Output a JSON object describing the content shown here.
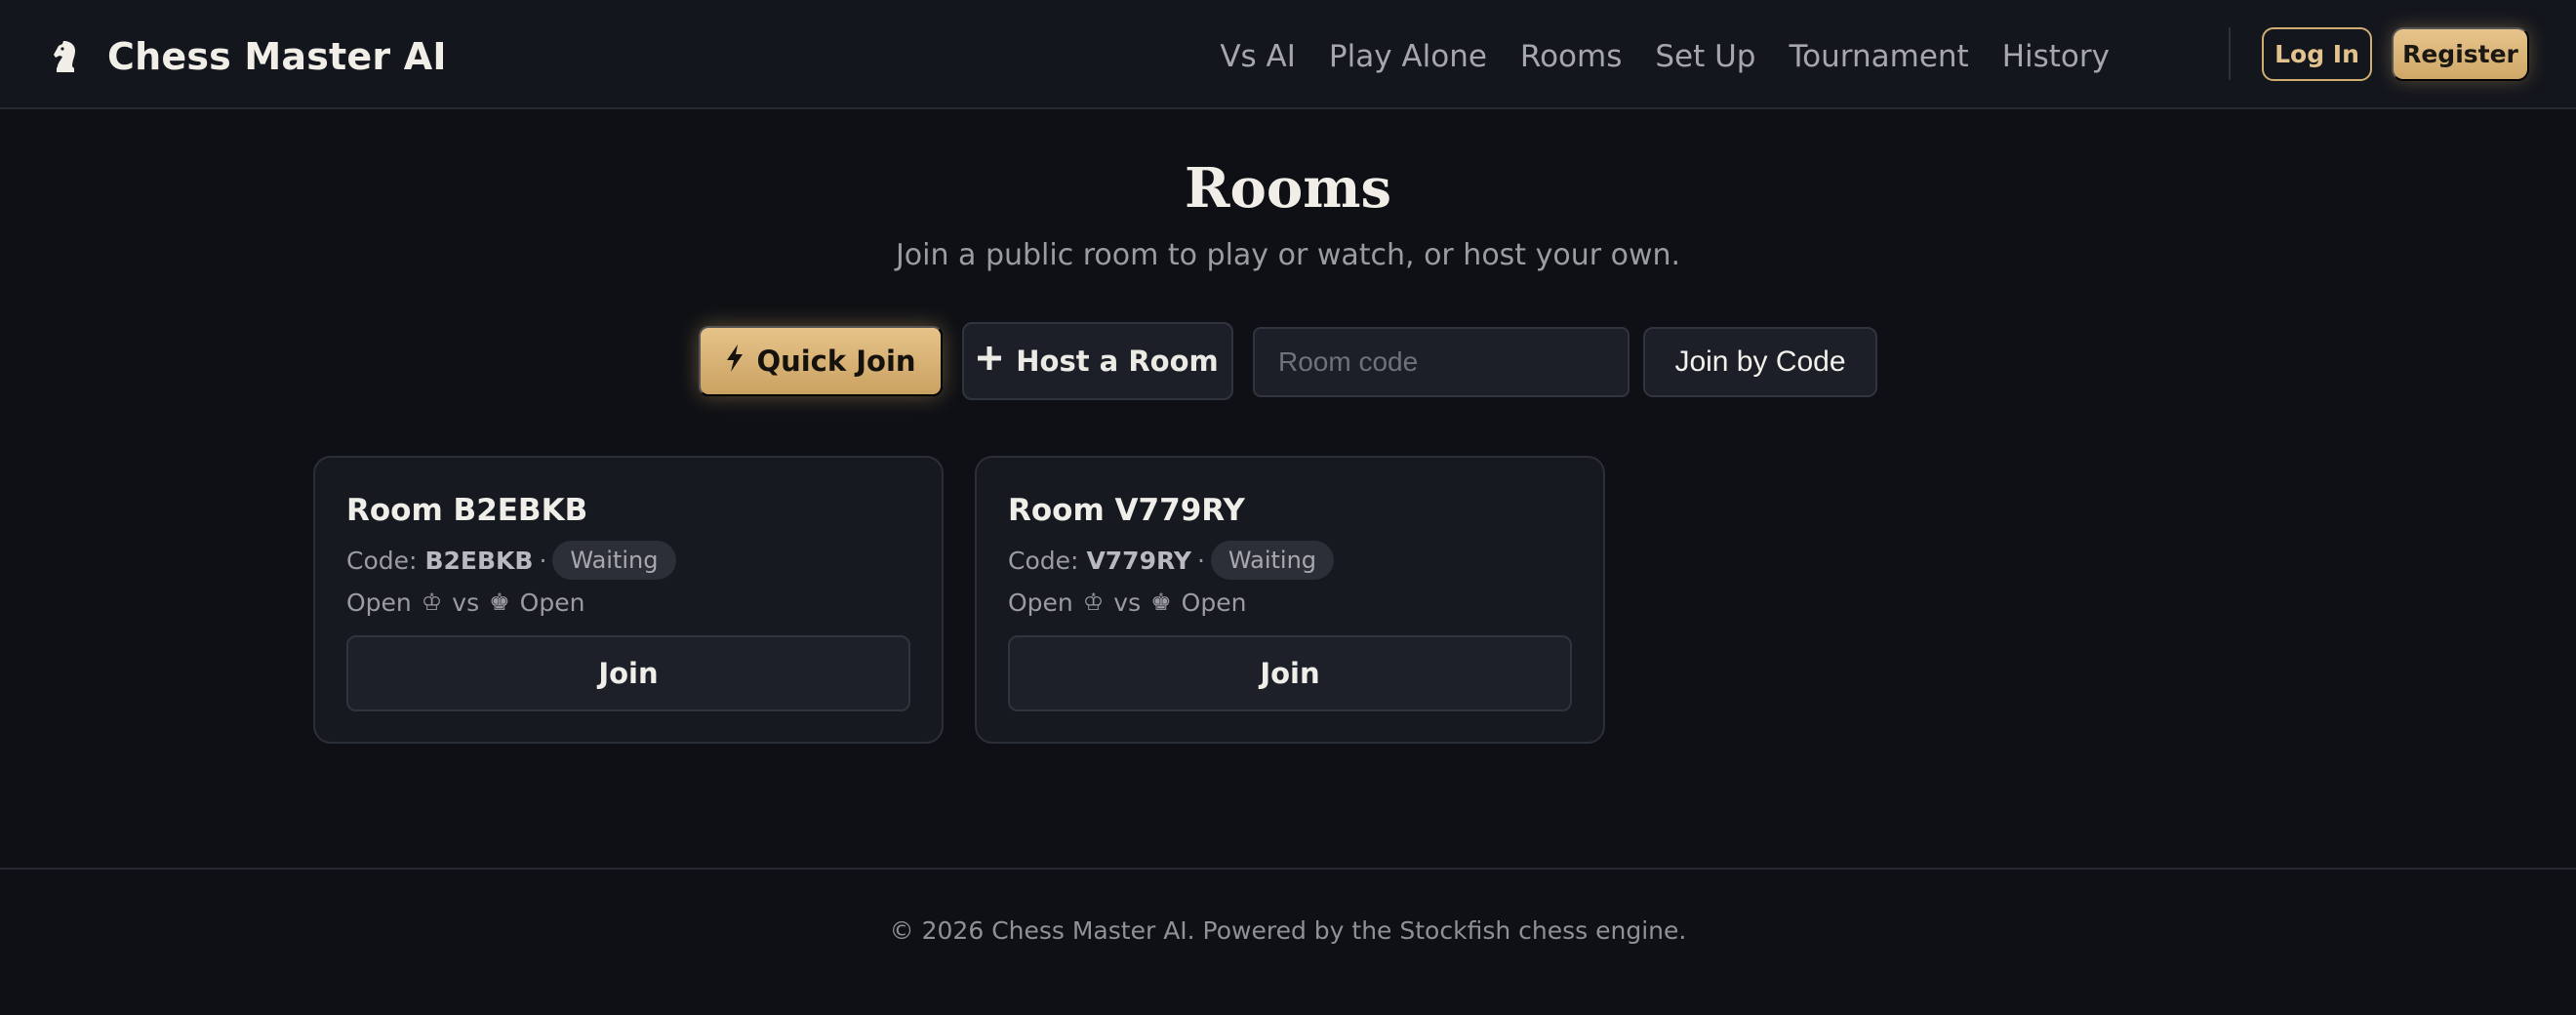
{
  "header": {
    "brand_icon": "knight-icon",
    "brand_title": "Chess Master AI",
    "nav": [
      "Vs AI",
      "Play Alone",
      "Rooms",
      "Set Up",
      "Tournament",
      "History"
    ],
    "login_label": "Log In",
    "register_label": "Register"
  },
  "hero": {
    "title": "Rooms",
    "subtitle": "Join a public room to play or watch, or host your own."
  },
  "actions": {
    "quick_join_label": "Quick Join",
    "quick_join_icon": "lightning-icon",
    "host_label": "Host a Room",
    "host_icon": "plus-icon",
    "room_code_placeholder": "Room code",
    "room_code_value": "",
    "join_by_code_label": "Join by Code"
  },
  "rooms": [
    {
      "title": "Room B2EBKB",
      "code_label": "Code:",
      "code": "B2EBKB",
      "status": "Waiting",
      "white": "Open",
      "vs": "vs",
      "black": "Open",
      "join_label": "Join"
    },
    {
      "title": "Room V779RY",
      "code_label": "Code:",
      "code": "V779RY",
      "status": "Waiting",
      "white": "Open",
      "vs": "vs",
      "black": "Open",
      "join_label": "Join"
    }
  ],
  "footer": {
    "text": "© 2026 Chess Master AI. Powered by the Stockfish chess engine."
  },
  "colors": {
    "background": "#0e1015",
    "accent": "#d6aa64",
    "card": "#161920"
  }
}
